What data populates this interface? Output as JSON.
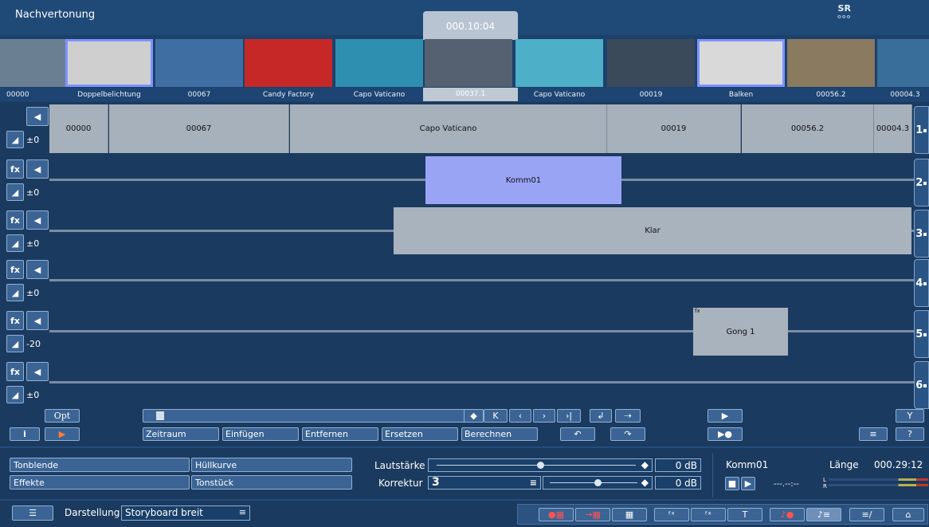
{
  "header": {
    "title": "Nachvertonung",
    "logo": "SR",
    "logo_sub": "ooo",
    "timecode": "000.10:04"
  },
  "thumbnails": [
    {
      "label": "00000",
      "bg": "#6b7f93"
    },
    {
      "label": "Doppelbelichtung",
      "bg": "#cfcfcf"
    },
    {
      "label": "00067",
      "bg": "#3f6ea3"
    },
    {
      "label": "Candy Factory",
      "bg": "#c62828"
    },
    {
      "label": "Capo Vaticano",
      "bg": "#2f8fb0"
    },
    {
      "label": "00037.1",
      "bg": "#556070"
    },
    {
      "label": "Capo Vaticano",
      "bg": "#4db0c8"
    },
    {
      "label": "00019",
      "bg": "#3a4a5a"
    },
    {
      "label": "Balken",
      "bg": "#d9d9d9"
    },
    {
      "label": "00056.2",
      "bg": "#8a7a60"
    },
    {
      "label": "00004.3",
      "bg": "#3a6e9a"
    }
  ],
  "tracks": [
    {
      "num": "1",
      "vol": "±0",
      "clips": [
        "00000",
        "00067",
        "Capo Vaticano",
        "00019",
        "00056.2",
        "00004.3"
      ]
    },
    {
      "num": "2",
      "vol": "±0",
      "clip": "Komm01"
    },
    {
      "num": "3",
      "vol": "±0",
      "clip": "Klar"
    },
    {
      "num": "4",
      "vol": "±0"
    },
    {
      "num": "5",
      "vol": "-20",
      "clip": "Gong 1",
      "clip_fx": "fx"
    },
    {
      "num": "6",
      "vol": "±0"
    }
  ],
  "controls": {
    "opt": "Opt",
    "info": "i",
    "zeitraum": "Zeitraum",
    "einfuegen": "Einfügen",
    "entfernen": "Entfernen",
    "ersetzen": "Ersetzen",
    "berechnen": "Berechnen",
    "help": "?"
  },
  "bottom": {
    "tonblende": "Tonblende",
    "huellkurve": "Hüllkurve",
    "effekte": "Effekte",
    "tonstueck": "Tonstück",
    "lautstaerke": "Lautstärke",
    "lautstaerke_val": "0 dB",
    "korrektur": "Korrektur",
    "korrektur_num": "3",
    "korrektur_val": "0 dB",
    "clip_name": "Komm01",
    "laenge": "Länge",
    "laenge_val": "000.29:12",
    "time_display": "---.--:--",
    "L": "L",
    "R": "R",
    "darstellung": "Darstellung",
    "darstellung_val": "Storyboard breit"
  }
}
